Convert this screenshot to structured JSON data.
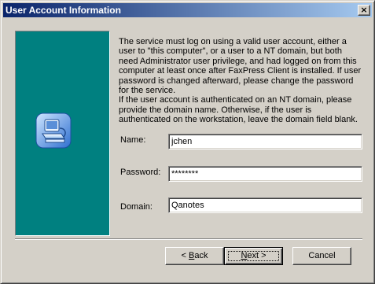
{
  "window": {
    "title": "User Account Information",
    "close_label": "×"
  },
  "panel": {
    "color": "#008080",
    "icon": "computer-icon"
  },
  "description": {
    "paragraph1": "The service must log on using a valid user account, either a user to \"this computer\", or a user to a NT domain, but both need Administrator user privilege, and had logged on from this computer at least once after FaxPress Client is installed. If user password is changed afterward, please change the password for the service.",
    "paragraph2": "If the user account is authenticated on an NT domain, please provide the domain name. Otherwise, if the user is authenticated on the workstation, leave the domain field blank."
  },
  "form": {
    "name_label": "Name:",
    "name_value": "jchen",
    "password_label": "Password:",
    "password_value": "********",
    "domain_label": "Domain:",
    "domain_value": "Qanotes"
  },
  "buttons": {
    "back_prefix": "< ",
    "back_mnemonic": "B",
    "back_rest": "ack",
    "next_mnemonic": "N",
    "next_rest": "ext",
    "next_suffix": " >",
    "cancel_label": "Cancel"
  }
}
